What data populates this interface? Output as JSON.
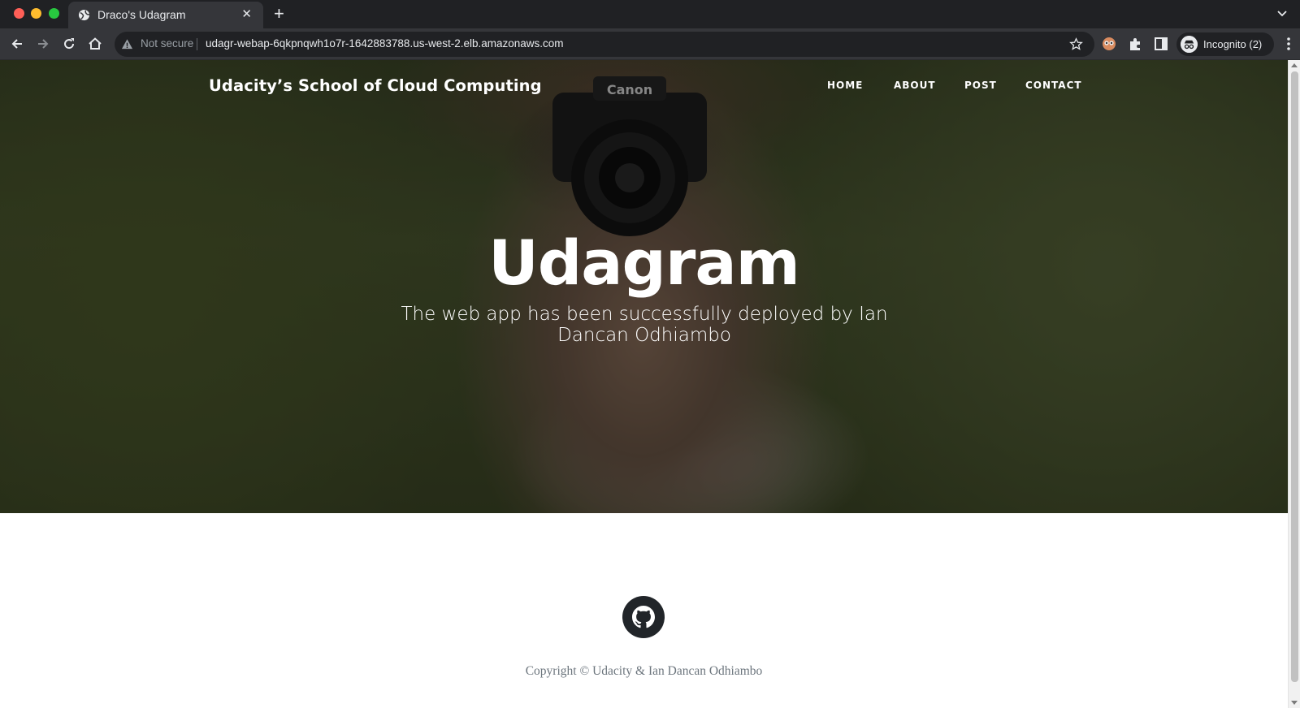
{
  "browser": {
    "tab_title": "Draco's Udagram",
    "tab_close": "✕",
    "new_tab": "+",
    "security_label": "Not secure",
    "url": "udagr-webap-6qkpnqwh1o7r-1642883788.us-west-2.elb.amazonaws.com",
    "incognito_label": "Incognito (2)"
  },
  "site": {
    "brand": "Udacity’s School of Cloud Computing",
    "nav": [
      "HOME",
      "ABOUT",
      "POST",
      "CONTACT"
    ],
    "hero_title": "Udagram",
    "hero_subtitle": "The web app has been successfully deployed by Ian Dancan Odhiambo",
    "camera_brand": "Canon",
    "footer_copyright": "Copyright © Udacity & Ian Dancan Odhiambo"
  }
}
